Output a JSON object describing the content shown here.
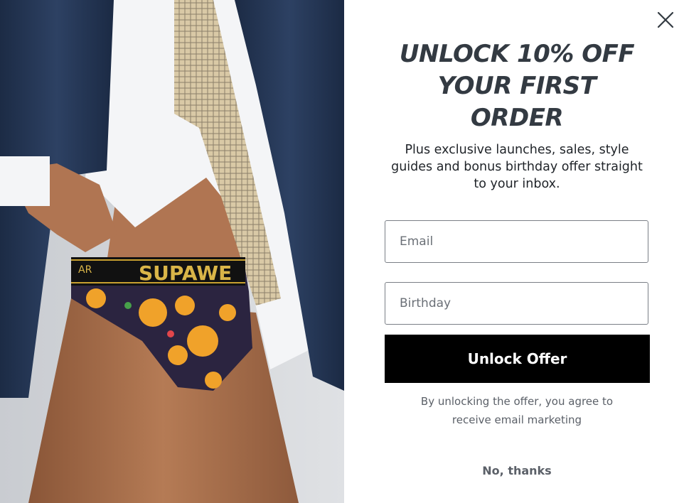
{
  "image": {
    "alt_icon": "product-photo",
    "waistband_text": "SUPAWEAR",
    "waistband_partial_left": "AR"
  },
  "close": {
    "icon": "close-icon"
  },
  "headline": {
    "line1": "UNLOCK 10% OFF",
    "line2": "YOUR FIRST",
    "line3": "ORDER"
  },
  "subtext": "Plus exclusive launches, sales, style guides and bonus birthday offer straight to your inbox.",
  "form": {
    "email_placeholder": "Email",
    "birthday_placeholder": "Birthday",
    "submit_label": "Unlock Offer"
  },
  "disclaimer": "By unlocking the offer, you agree to receive email marketing",
  "decline_label": "No, thanks",
  "colors": {
    "headline": "#333a42",
    "button_bg": "#000000",
    "button_text": "#ffffff",
    "muted_text": "#5b6068"
  }
}
